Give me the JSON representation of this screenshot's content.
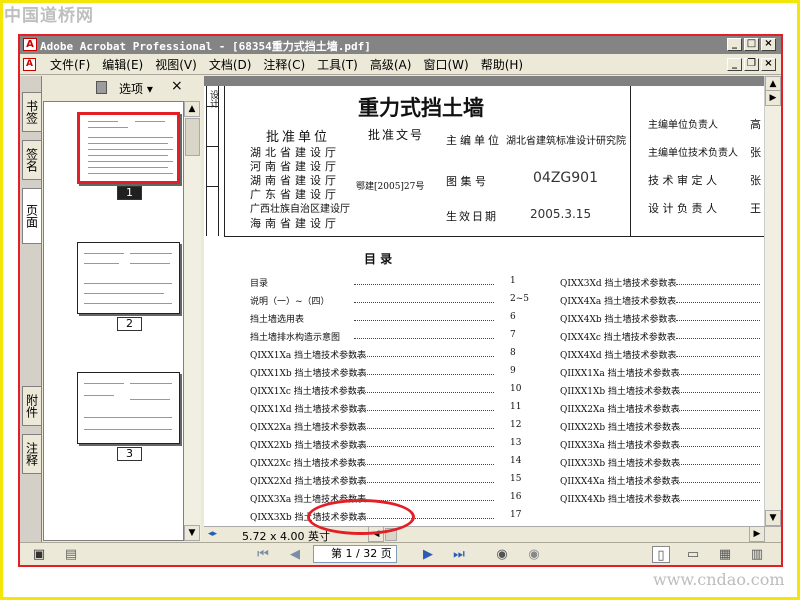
{
  "site": {
    "logo": "中国道桥网",
    "url": "www.cndao.com"
  },
  "window": {
    "title": "Adobe Acrobat Professional - [68354重力式挡土墙.pdf]"
  },
  "menu": [
    "文件(F)",
    "编辑(E)",
    "视图(V)",
    "文档(D)",
    "注释(C)",
    "工具(T)",
    "高级(A)",
    "窗口(W)",
    "帮助(H)"
  ],
  "nav_tabs": [
    "书签",
    "签名",
    "页面",
    "附件",
    "注释"
  ],
  "panel": {
    "options_label": "选项 ▾",
    "close": "×",
    "thumbnails": [
      "1",
      "2",
      "3"
    ]
  },
  "status": {
    "page_size": "5.72 x 4.00 英寸",
    "page_indicator": "第 1 / 32 页",
    "current_page": 1,
    "total_pages": 32
  },
  "doc": {
    "title": "重力式挡土墙",
    "left_side_vertical": "设计",
    "approval_unit_label": "批准单位",
    "approval_units": [
      "湖北省建设厅",
      "河南省建设厅",
      "湖南省建设厅",
      "广东省建设厅",
      "广西壮族自治区建设厅",
      "海南省建设厅"
    ],
    "approval_doc_label": "批准文号",
    "approval_doc_no": "鄂建[2005]27号",
    "editor_label": "主编单位",
    "editor_value": "湖北省建筑标准设计研究院",
    "atlas_label": "图 集 号",
    "atlas_no": "04ZG901",
    "effective_label": "生效日期",
    "effective_date": "2005.3.15",
    "right_roles": [
      "主编单位负责人",
      "主编单位技术负责人",
      "技 术 审 定 人",
      "设 计 负 责 人"
    ],
    "right_names": [
      "高",
      "张",
      "张",
      "王"
    ],
    "toc_title": "目 录",
    "toc_left": [
      {
        "name": "目录",
        "page": "1"
      },
      {
        "name": "说明（一）~（四）",
        "page": "2~5"
      },
      {
        "name": "挡土墙选用表",
        "page": "6"
      },
      {
        "name": "挡土墙排水构造示意图",
        "page": "7"
      },
      {
        "name": "QIXX1Xa 挡土墙技术参数表",
        "page": "8"
      },
      {
        "name": "QIXX1Xb 挡土墙技术参数表",
        "page": "9"
      },
      {
        "name": "QIXX1Xc 挡土墙技术参数表",
        "page": "10"
      },
      {
        "name": "QIXX1Xd 挡土墙技术参数表",
        "page": "11"
      },
      {
        "name": "QIXX2Xa 挡土墙技术参数表",
        "page": "12"
      },
      {
        "name": "QIXX2Xb 挡土墙技术参数表",
        "page": "13"
      },
      {
        "name": "QIXX2Xc 挡土墙技术参数表",
        "page": "14"
      },
      {
        "name": "QIXX2Xd 挡土墙技术参数表",
        "page": "15"
      },
      {
        "name": "QIXX3Xa 挡土墙技术参数表",
        "page": "16"
      },
      {
        "name": "QIXX3Xb 挡土墙技术参数表",
        "page": "17"
      }
    ],
    "toc_right": [
      "QIXX3Xd 挡土墙技术参数表",
      "QIXX4Xa 挡土墙技术参数表",
      "QIXX4Xb 挡土墙技术参数表",
      "QIXX4Xc 挡土墙技术参数表",
      "QIXX4Xd 挡土墙技术参数表",
      "QIIXX1Xa 挡土墙技术参数表",
      "QIIXX1Xb 挡土墙技术参数表",
      "QIIXX2Xa 挡土墙技术参数表",
      "QIIXX2Xb 挡土墙技术参数表",
      "QIIXX3Xa 挡土墙技术参数表",
      "QIIXX3Xb 挡土墙技术参数表",
      "QIIXX4Xa 挡土墙技术参数表",
      "QIIXX4Xb 挡土墙技术参数表"
    ]
  }
}
